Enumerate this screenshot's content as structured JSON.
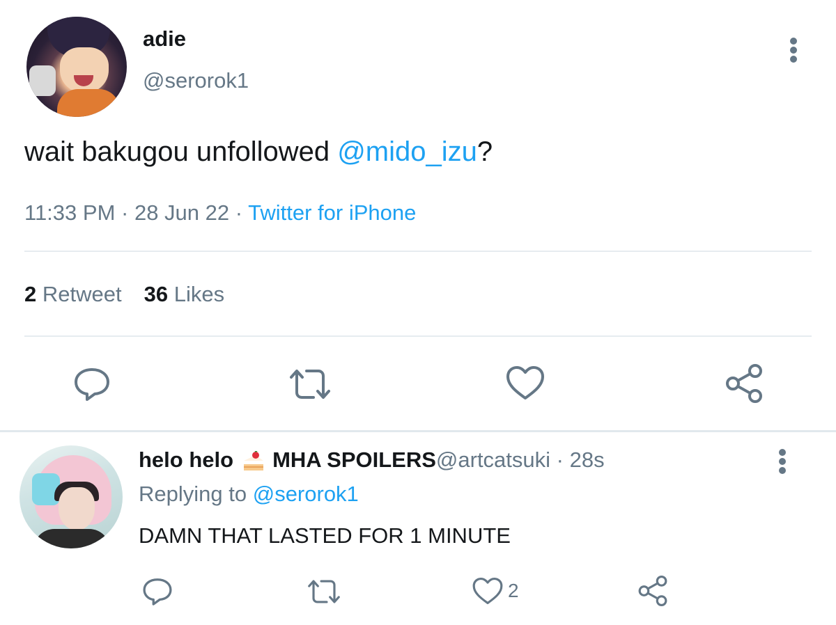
{
  "main_tweet": {
    "name": "adie",
    "handle": "@serorok1",
    "text_prefix": "wait bakugou unfollowed ",
    "text_mention": "@mido_izu",
    "text_suffix": "?",
    "time": "11:33 PM",
    "sep1": " · ",
    "date": "28 Jun 22",
    "sep2": " · ",
    "source": "Twitter for iPhone",
    "stats": {
      "retweets_count": "2",
      "retweets_label": "Retweet",
      "likes_count": "36",
      "likes_label": "Likes"
    },
    "actions": {
      "reply_icon": "reply-icon",
      "retweet_icon": "retweet-icon",
      "like_icon": "heart-icon",
      "share_icon": "share-icon"
    }
  },
  "reply_tweet": {
    "name": "helo helo",
    "emoji": "cake-icon",
    "name_suffix": "MHA SPOILERS",
    "handle_time": " @artcatsuki · 28s",
    "replying_prefix": "Replying to ",
    "replying_mention": "@serorok1",
    "text": "DAMN THAT LASTED FOR 1 MINUTE",
    "like_count": "2"
  },
  "colors": {
    "accent": "#1da1f2",
    "secondary_text": "#657786",
    "primary_text": "#14171a",
    "divider": "#e6ecf0"
  }
}
